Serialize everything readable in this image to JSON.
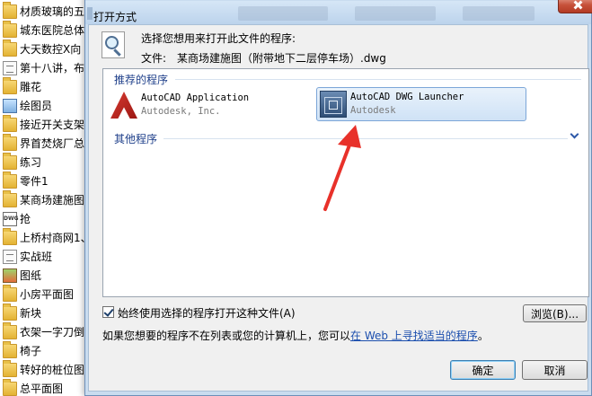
{
  "file_list": [
    {
      "name": "材质玻璃的五",
      "icon": "folder-icon"
    },
    {
      "name": "城东医院总体",
      "icon": "folder-icon"
    },
    {
      "name": "大天数控X向",
      "icon": "folder-icon"
    },
    {
      "name": "第十八讲，布",
      "icon": "document-icon"
    },
    {
      "name": "雕花",
      "icon": "folder-icon"
    },
    {
      "name": "绘图员",
      "icon": "image-icon"
    },
    {
      "name": "接近开关支架",
      "icon": "folder-icon"
    },
    {
      "name": "界首焚烧厂总",
      "icon": "folder-icon"
    },
    {
      "name": "练习",
      "icon": "folder-icon"
    },
    {
      "name": "零件1",
      "icon": "folder-icon"
    },
    {
      "name": "某商场建施图",
      "icon": "folder-icon"
    },
    {
      "name": "抢",
      "icon": "dwg-file-icon"
    },
    {
      "name": "上桥村商网1、",
      "icon": "folder-icon"
    },
    {
      "name": "实战班",
      "icon": "document-icon"
    },
    {
      "name": "图纸",
      "icon": "presentation-icon"
    },
    {
      "name": "小房平面图",
      "icon": "folder-icon"
    },
    {
      "name": "新块",
      "icon": "folder-icon"
    },
    {
      "name": "衣架一字刀倒",
      "icon": "folder-icon"
    },
    {
      "name": "椅子",
      "icon": "folder-icon"
    },
    {
      "name": "转好的桩位图",
      "icon": "folder-icon"
    },
    {
      "name": "总平面图",
      "icon": "folder-icon"
    }
  ],
  "dwg_badge": "DWG",
  "dialog": {
    "title": "打开方式",
    "prompt": "选择您想用来打开此文件的程序:",
    "file_label": "文件:",
    "file_name": "某商场建施图（附带地下二层停车场）.dwg",
    "recommended_heading": "推荐的程序",
    "programs": [
      {
        "name": "AutoCAD Application",
        "vendor": "Autodesk, Inc.",
        "icon": "autocad-icon",
        "selected": false
      },
      {
        "name": "AutoCAD DWG Launcher",
        "vendor": "Autodesk",
        "icon": "dwg-launcher-icon",
        "selected": true
      }
    ],
    "other_heading": "其他程序",
    "always_use_label": "始终使用选择的程序打开这种文件(A)",
    "always_use_checked": true,
    "browse_label": "浏览(B)...",
    "hint_text": "如果您想要的程序不在列表或您的计算机上，您可以",
    "hint_link": "在 Web 上寻找适当的程序",
    "hint_end": "。",
    "ok_label": "确定",
    "cancel_label": "取消"
  },
  "colors": {
    "annotation_arrow": "#e8312a",
    "selected_bg": "#cfe2f6",
    "heading": "#1e3f8a",
    "link": "#1c4fae"
  }
}
